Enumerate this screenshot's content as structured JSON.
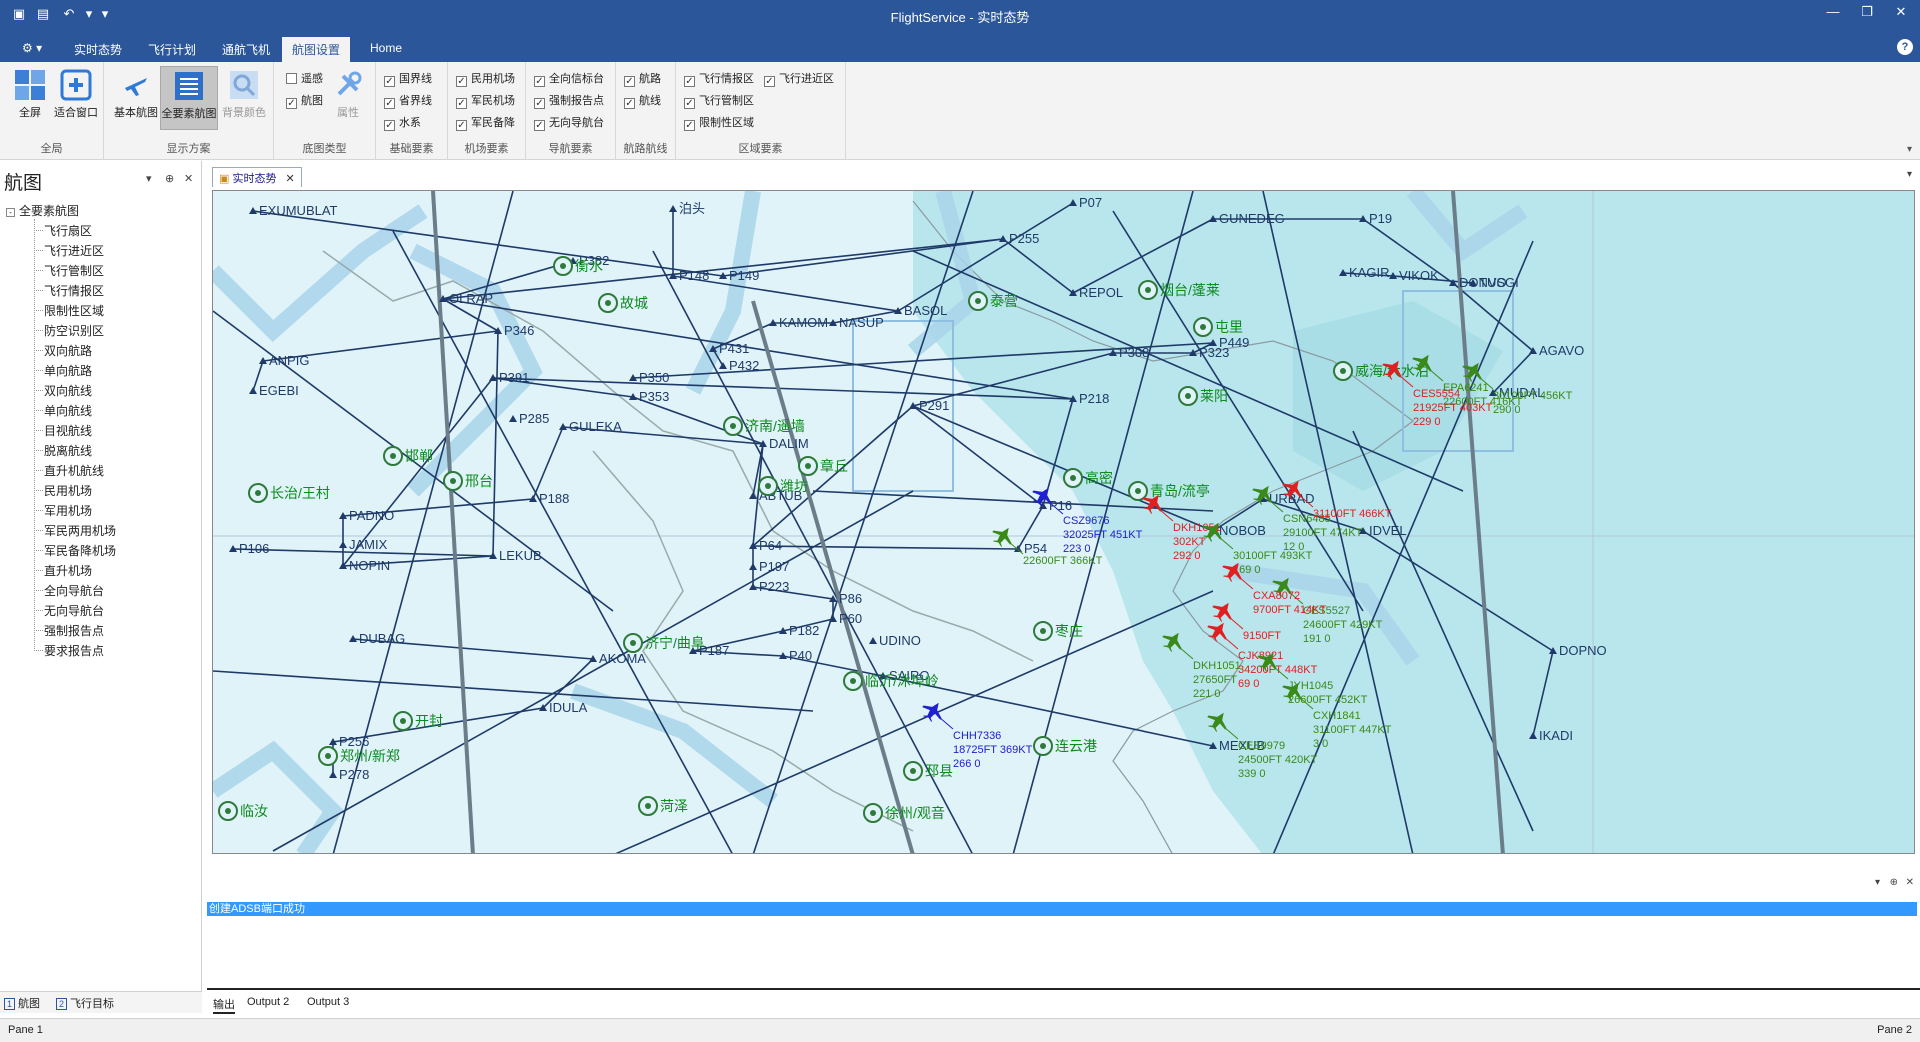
{
  "app": {
    "title": "FlightService - 实时态势"
  },
  "ribbon_tabs": [
    {
      "label": "实时态势"
    },
    {
      "label": "飞行计划"
    },
    {
      "label": "通航飞机"
    },
    {
      "label": "航图设置"
    },
    {
      "label": "Home"
    }
  ],
  "ribbon": {
    "groups": {
      "global": "全局",
      "display": "显示方案",
      "base_map": "底图类型",
      "basic": "基础要素",
      "airport": "机场要素",
      "navaid": "导航要素",
      "route": "航路航线",
      "area": "区域要素"
    },
    "buttons": {
      "fullscreen": "全屏",
      "fit_window": "适合窗口",
      "basic_chart": "基本航图",
      "all_elements": "全要素航图",
      "bg_color": "背景颜色",
      "properties": "属性"
    },
    "checks": {
      "remote": "遥感",
      "chart": "航图",
      "national_border": "国界线",
      "province_border": "省界线",
      "water": "水系",
      "civil_airport": "民用机场",
      "military_civil_airport": "军民机场",
      "military_civil_backup": "军民备降",
      "omni_beacon": "全向信标台",
      "mandatory_report": "强制报告点",
      "ndb": "无向导航台",
      "airway": "航路",
      "air_route": "航线",
      "fir": "飞行情报区",
      "control_area": "飞行管制区",
      "restricted_area": "限制性区域",
      "approach_area": "飞行进近区"
    }
  },
  "left_panel": {
    "title": "航图",
    "root": "全要素航图",
    "items": [
      "飞行扇区",
      "飞行进近区",
      "飞行管制区",
      "飞行情报区",
      "限制性区域",
      "防空识别区",
      "双向航路",
      "单向航路",
      "双向航线",
      "单向航线",
      "目视航线",
      "脱离航线",
      "直升机航线",
      "民用机场",
      "军用机场",
      "军民两用机场",
      "军民备降机场",
      "直升机场",
      "全向导航台",
      "无向导航台",
      "强制报告点",
      "要求报告点"
    ],
    "tabs": [
      {
        "num": "1",
        "label": "航图"
      },
      {
        "num": "2",
        "label": "飞行目标"
      }
    ]
  },
  "document": {
    "tab_label": "实时态势"
  },
  "map": {
    "waypoints": [
      "EXUMUBLAT",
      "泊头",
      "P07",
      "GUNEDEG",
      "P19",
      "DONVO",
      "AGAVO",
      "MUDAL",
      "KAGIR",
      "VIKOK",
      "TUSGI",
      "P255",
      "OLRAP",
      "P346",
      "ANPIG",
      "EGEBI",
      "P391",
      "P353",
      "P285",
      "P218",
      "P308",
      "P323",
      "P449",
      "P350",
      "P291",
      "DALIM",
      "GULEKA",
      "P188",
      "PADNO",
      "JAMIX",
      "NOPIN",
      "LEKUB",
      "P106",
      "DUBAG",
      "AKOMA",
      "IDULA",
      "P256",
      "P278",
      "P64",
      "P197",
      "P223",
      "P86",
      "P60",
      "P182",
      "P187",
      "P40",
      "SAIRO",
      "MEXUB",
      "NOBOB",
      "URBAD",
      "IDVEL",
      "DOPNO",
      "IKADI",
      "P148",
      "P149",
      "BASOL",
      "REPOL",
      "P382",
      "P54",
      "P16",
      "ABTUB",
      "P432",
      "P431",
      "KAMOM",
      "NASUP",
      "UDINO"
    ],
    "airports": [
      "衡水",
      "故城",
      "泰营",
      "邯郸",
      "邢台",
      "长治/王村",
      "济南/遥墙",
      "济宁/曲阜",
      "开封",
      "郑州/新郑",
      "临汝",
      "临沂/沭埠岭",
      "连云港",
      "徐州/观音",
      "菏泽",
      "潍坊",
      "高密",
      "青岛/流亭",
      "烟台/蓬莱",
      "威海/大水泊",
      "莱阳",
      "屯里",
      "章丘",
      "枣庄",
      "邳县"
    ],
    "flights": [
      {
        "callsign": "EPA6241",
        "alt": "22600FT 416KT",
        "hdg": "",
        "color": "#3a8a1a"
      },
      {
        "callsign": "CES5554",
        "alt": "21925FT 403KT",
        "hdg": "229 0",
        "color": "#e02020"
      },
      {
        "callsign": "CSZ9676",
        "alt": "32025FT 451KT",
        "hdg": "223 0",
        "color": "#2020d0"
      },
      {
        "callsign": "DKH1051",
        "alt": "302KT",
        "hdg": "292 0",
        "color": "#e02020"
      },
      {
        "callsign": "CSN6485",
        "alt": "29100FT 474KT",
        "hdg": "12 0",
        "color": "#3a8a1a"
      },
      {
        "callsign": "",
        "alt": "31100FT 466KT",
        "hdg": "",
        "color": "#e02020"
      },
      {
        "callsign": "",
        "alt": "30100FT 456KT",
        "hdg": "290 0",
        "color": "#3a8a1a"
      },
      {
        "callsign": "",
        "alt": "22600FT 366KT",
        "hdg": "",
        "color": "#3a8a1a"
      },
      {
        "callsign": "",
        "alt": "30100FT 493KT",
        "hdg": "169 0",
        "color": "#3a8a1a"
      },
      {
        "callsign": "CES5527",
        "alt": "24600FT 429KT",
        "hdg": "191 0",
        "color": "#3a8a1a"
      },
      {
        "callsign": "CXA8072",
        "alt": "9700FT 414KT",
        "hdg": "",
        "color": "#e02020"
      },
      {
        "callsign": "",
        "alt": "9150FT",
        "hdg": "",
        "color": "#e02020"
      },
      {
        "callsign": "CJK8921",
        "alt": "34200FT 448KT",
        "hdg": "69 0",
        "color": "#e02020"
      },
      {
        "callsign": "JYH1045",
        "alt": "26600FT 452KT",
        "hdg": "",
        "color": "#3a8a1a"
      },
      {
        "callsign": "CXH1841",
        "alt": "31100FT 447KT",
        "hdg": "3 0",
        "color": "#3a8a1a"
      },
      {
        "callsign": "DKH1051",
        "alt": "27650FT",
        "hdg": "221 0",
        "color": "#3a8a1a"
      },
      {
        "callsign": "CES9979",
        "alt": "24500FT 420KT",
        "hdg": "339 0",
        "color": "#3a8a1a"
      },
      {
        "callsign": "CHH7336",
        "alt": "18725FT 369KT",
        "hdg": "266 0",
        "color": "#2020d0"
      }
    ]
  },
  "output": {
    "message": "创建ADSB端口成功",
    "tabs": [
      "输出",
      "Output 2",
      "Output 3"
    ]
  },
  "status": {
    "left": "Pane 1",
    "right": "Pane 2"
  },
  "colors": {
    "titlebar": "#2b579a",
    "map_bg": "#dff3f8",
    "map_sea": "#b8e6ec",
    "route_line": "#1f3a68",
    "airspace": "#a9d4ea",
    "friendly_plane": "#3a8a1a",
    "alert_plane": "#e02020",
    "own_plane": "#2020d0"
  }
}
